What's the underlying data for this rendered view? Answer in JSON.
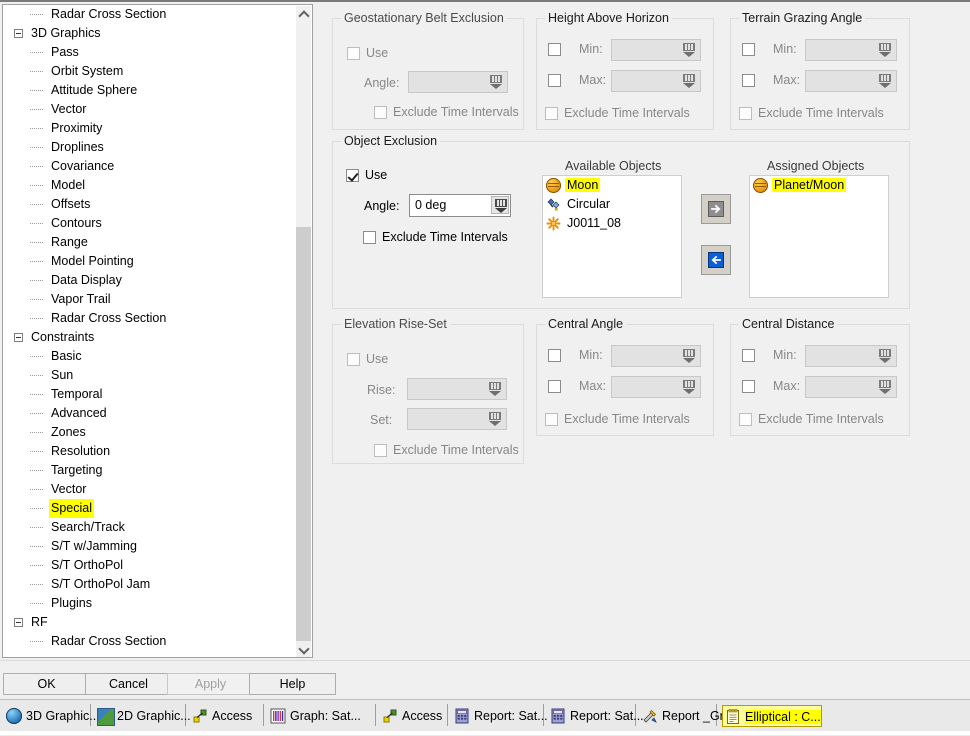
{
  "tree": {
    "items": [
      {
        "label": "Radar Cross Section",
        "depth": 2,
        "type": "leaf",
        "highlight": false
      },
      {
        "label": "3D Graphics",
        "depth": 1,
        "type": "group",
        "highlight": false
      },
      {
        "label": "Pass",
        "depth": 2,
        "type": "leaf",
        "highlight": false
      },
      {
        "label": "Orbit System",
        "depth": 2,
        "type": "leaf",
        "highlight": false
      },
      {
        "label": "Attitude Sphere",
        "depth": 2,
        "type": "leaf",
        "highlight": false
      },
      {
        "label": "Vector",
        "depth": 2,
        "type": "leaf",
        "highlight": false
      },
      {
        "label": "Proximity",
        "depth": 2,
        "type": "leaf",
        "highlight": false
      },
      {
        "label": "Droplines",
        "depth": 2,
        "type": "leaf",
        "highlight": false
      },
      {
        "label": "Covariance",
        "depth": 2,
        "type": "leaf",
        "highlight": false
      },
      {
        "label": "Model",
        "depth": 2,
        "type": "leaf",
        "highlight": false
      },
      {
        "label": "Offsets",
        "depth": 2,
        "type": "leaf",
        "highlight": false
      },
      {
        "label": "Contours",
        "depth": 2,
        "type": "leaf",
        "highlight": false
      },
      {
        "label": "Range",
        "depth": 2,
        "type": "leaf",
        "highlight": false
      },
      {
        "label": "Model Pointing",
        "depth": 2,
        "type": "leaf",
        "highlight": false
      },
      {
        "label": "Data Display",
        "depth": 2,
        "type": "leaf",
        "highlight": false
      },
      {
        "label": "Vapor Trail",
        "depth": 2,
        "type": "leaf",
        "highlight": false
      },
      {
        "label": "Radar Cross Section",
        "depth": 2,
        "type": "leaf",
        "highlight": false
      },
      {
        "label": "Constraints",
        "depth": 1,
        "type": "group",
        "highlight": false
      },
      {
        "label": "Basic",
        "depth": 2,
        "type": "leaf",
        "highlight": false
      },
      {
        "label": "Sun",
        "depth": 2,
        "type": "leaf",
        "highlight": false
      },
      {
        "label": "Temporal",
        "depth": 2,
        "type": "leaf",
        "highlight": false
      },
      {
        "label": "Advanced",
        "depth": 2,
        "type": "leaf",
        "highlight": false
      },
      {
        "label": "Zones",
        "depth": 2,
        "type": "leaf",
        "highlight": false
      },
      {
        "label": "Resolution",
        "depth": 2,
        "type": "leaf",
        "highlight": false
      },
      {
        "label": "Targeting",
        "depth": 2,
        "type": "leaf",
        "highlight": false
      },
      {
        "label": "Vector",
        "depth": 2,
        "type": "leaf",
        "highlight": false
      },
      {
        "label": "Special",
        "depth": 2,
        "type": "leaf",
        "highlight": true
      },
      {
        "label": "Search/Track",
        "depth": 2,
        "type": "leaf",
        "highlight": false
      },
      {
        "label": "S/T w/Jamming",
        "depth": 2,
        "type": "leaf",
        "highlight": false
      },
      {
        "label": "S/T OrthoPol",
        "depth": 2,
        "type": "leaf",
        "highlight": false
      },
      {
        "label": "S/T OrthoPol Jam",
        "depth": 2,
        "type": "leaf",
        "highlight": false
      },
      {
        "label": "Plugins",
        "depth": 2,
        "type": "leaf",
        "highlight": false
      },
      {
        "label": "RF",
        "depth": 1,
        "type": "group",
        "highlight": false
      },
      {
        "label": "Radar Cross Section",
        "depth": 2,
        "type": "leaf",
        "highlight": false
      }
    ]
  },
  "panels": {
    "geo_belt": {
      "title": "Geostationary Belt Exclusion",
      "use_label": "Use",
      "use_checked": false,
      "use_enabled": false,
      "angle_label": "Angle:",
      "angle_value": "",
      "angle_enabled": false,
      "exclude_label": "Exclude Time Intervals",
      "exclude_checked": false,
      "exclude_enabled": false
    },
    "height_above_horizon": {
      "title": "Height Above Horizon",
      "min_label": "Min:",
      "min_checked": false,
      "min_value": "",
      "max_label": "Max:",
      "max_checked": false,
      "max_value": "",
      "exclude_label": "Exclude Time Intervals",
      "exclude_checked": false,
      "exclude_enabled": false
    },
    "terrain_grazing_angle": {
      "title": "Terrain Grazing Angle",
      "min_label": "Min:",
      "min_checked": false,
      "min_value": "",
      "max_label": "Max:",
      "max_checked": false,
      "max_value": "",
      "exclude_label": "Exclude Time Intervals",
      "exclude_checked": false,
      "exclude_enabled": false
    },
    "object_exclusion": {
      "title": "Object Exclusion",
      "use_label": "Use",
      "use_checked": true,
      "angle_label": "Angle:",
      "angle_value": "0 deg",
      "angle_enabled": true,
      "exclude_label": "Exclude Time Intervals",
      "exclude_checked": false,
      "exclude_enabled": true,
      "available_header": "Available Objects",
      "available_items": [
        {
          "label": "Moon",
          "icon": "moon-icon",
          "highlight": true
        },
        {
          "label": "Circular",
          "icon": "satellite-icon",
          "highlight": false
        },
        {
          "label": "J0011_08",
          "icon": "star-icon",
          "highlight": false
        }
      ],
      "assigned_header": "Assigned Objects",
      "assigned_items": [
        {
          "label": "Planet/Moon",
          "icon": "moon-icon",
          "highlight": true
        }
      ],
      "assign_button": "assign-right-arrow",
      "unassign_button": "unassign-left-arrow"
    },
    "elevation_rise_set": {
      "title": "Elevation Rise-Set",
      "use_label": "Use",
      "use_checked": false,
      "use_enabled": false,
      "rise_label": "Rise:",
      "rise_value": "",
      "set_label": "Set:",
      "set_value": "",
      "exclude_label": "Exclude Time Intervals",
      "exclude_checked": false,
      "exclude_enabled": false
    },
    "central_angle": {
      "title": "Central Angle",
      "min_label": "Min:",
      "min_checked": false,
      "min_value": "",
      "max_label": "Max:",
      "max_checked": false,
      "max_value": "",
      "exclude_label": "Exclude Time Intervals",
      "exclude_checked": false,
      "exclude_enabled": false
    },
    "central_distance": {
      "title": "Central Distance",
      "min_label": "Min:",
      "min_checked": false,
      "min_value": "",
      "max_label": "Max:",
      "max_checked": false,
      "max_value": "",
      "exclude_label": "Exclude Time Intervals",
      "exclude_checked": false,
      "exclude_enabled": false
    }
  },
  "buttons": {
    "ok": "OK",
    "cancel": "Cancel",
    "apply": "Apply",
    "apply_enabled": false,
    "help": "Help"
  },
  "taskbar": {
    "items": [
      {
        "label": "3D Graphic...",
        "icon": "globe-icon",
        "active": false
      },
      {
        "label": "2D Graphic...",
        "icon": "map-icon",
        "active": false
      },
      {
        "label": "Access",
        "icon": "access-icon",
        "active": false
      },
      {
        "label": "Graph:  Sat...",
        "icon": "graph-icon",
        "active": false
      },
      {
        "label": "Access",
        "icon": "access-icon",
        "active": false
      },
      {
        "label": "Report:  Sat...",
        "icon": "report-icon",
        "active": false
      },
      {
        "label": "Report:  Sat...",
        "icon": "report-icon",
        "active": false
      },
      {
        "label": "Report _Gr...",
        "icon": "tools-icon",
        "active": false
      },
      {
        "label": "Elliptical : C...",
        "icon": "clipboard-icon",
        "active": true
      }
    ]
  },
  "colors": {
    "highlight": "#ffff00",
    "dialog_bg": "#f0f0f0",
    "list_bg": "#ffffff",
    "accent_blue": "#0b5ed7"
  }
}
